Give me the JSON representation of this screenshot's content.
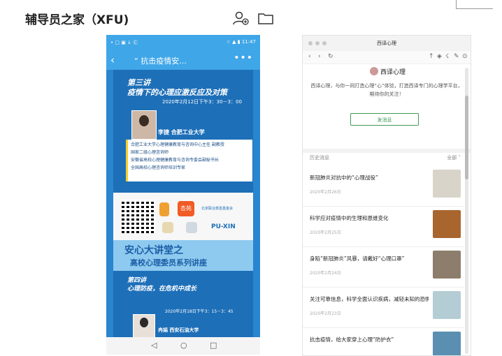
{
  "header": {
    "title": "辅导员之家（XFU)",
    "icons": [
      "add-contact-icon",
      "folder-icon"
    ]
  },
  "phone": {
    "status_left": "• ▢ ▣ ↓ Ⓒ",
    "status_right": "☆ ▲ ▮ 11:47",
    "nav": {
      "back": "‹",
      "title": "“ 抗击疫情安...",
      "more": "•••"
    },
    "poster1": {
      "lead": "第三讲",
      "title": "疫情下的心理应激反应及对策",
      "date": "2020年2月12日下午3：30－3：00",
      "speaker": "李捷  合肥工业大学",
      "bio": [
        "合肥工业大学心理健康教育与咨询中心主任 副教授",
        "国家二级心理咨询师",
        "安徽省高校心理健康教育与咨询专委会副秘书长",
        "全国高校心理咨询师培训专家"
      ]
    },
    "logos": {
      "texts": [
        "杏苑",
        "北京联合慈善基金会",
        "PU-XIN"
      ]
    },
    "poster2": {
      "big": "安心大讲堂之",
      "sub": "高校心理委员系列讲座",
      "lead": "第四讲",
      "title": "心理防疫，在危机中成长",
      "date": "2020年2月18日下午3：15－3：45",
      "speaker": "冉娟  西安石油大学"
    },
    "bottom_nav": [
      "◁",
      "○",
      "□"
    ]
  },
  "window": {
    "title": "西译心理",
    "toolbar": {
      "left": [
        "‹",
        "›",
        "↻"
      ],
      "right": [
        "↑",
        "◈",
        "☇",
        "✎",
        "⊙"
      ]
    },
    "account": {
      "name": "西译心理",
      "description": "西译心理，与你一同打造心理“心”体验，打造西译专门的心理学平台，期待你的关注！",
      "message_button": "发消息"
    },
    "history": {
      "label": "历史消息",
      "filter": "全部 ˅"
    },
    "articles": [
      {
        "title": "新冠肺炎对抗中的“心理战役”",
        "date": "2020年2月26日",
        "thumb_color": "#d9d4c9"
      },
      {
        "title": "科学应对疫情中的生理和恩维变化",
        "date": "2020年2月25日",
        "thumb_color": "#a8652d"
      },
      {
        "title": "身陷“新冠肺炎”风暴，请戴好“心理口罩”",
        "date": "2020年2月24日",
        "thumb_color": "#8d7d6c"
      },
      {
        "title": "关注可靠信息，科学全面认识疾病，减轻未知的恐惧",
        "date": "2020年2月23日",
        "thumb_color": "#b4cdd5"
      },
      {
        "title": "抗击疫情，给大家穿上心理“防护衣”",
        "date": "",
        "thumb_color": "#5b8fb1"
      }
    ]
  }
}
